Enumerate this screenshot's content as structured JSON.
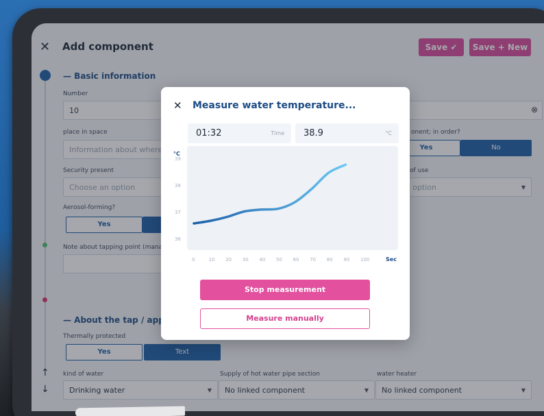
{
  "header": {
    "title": "Add component",
    "save_label": "Save",
    "save_new_label": "Save + New"
  },
  "form": {
    "basic_section": "— Basic information",
    "number_label": "Number",
    "number_value": "10",
    "place_label": "place in space",
    "place_placeholder": "Information about where t",
    "order_label": "onent; in order?",
    "order_yes": "Yes",
    "order_no": "No",
    "security_label": "Security present",
    "security_placeholder": "Choose an option",
    "use_label": "of use",
    "use_placeholder": "an option",
    "aerosol_label": "Aerosol-forming?",
    "aerosol_yes": "Yes",
    "note_label": "Note about tapping point (manag",
    "tap_section": "— About the tap / applia",
    "thermal_label": "Thermally protected",
    "thermal_yes": "Yes",
    "thermal_text": "Text",
    "kind_label": "kind of water",
    "kind_value": "Drinking water",
    "supply_label": "Supply of hot water pipe section",
    "supply_value": "No linked component",
    "heater_label": "water heater",
    "heater_value": "No linked component"
  },
  "modal": {
    "title": "Measure water temperature...",
    "time_value": "01:32",
    "time_unit": "Time",
    "temp_value": "38.9",
    "temp_unit": "°C",
    "stop_label": "Stop measurement",
    "manual_label": "Measure manually"
  },
  "chart_data": {
    "type": "line",
    "title": "",
    "xlabel": "Sec",
    "ylabel": "°C",
    "x_ticks": [
      "0",
      "10",
      "20",
      "30",
      "40",
      "50",
      "60",
      "70",
      "80",
      "90",
      "100"
    ],
    "y_ticks": [
      "39",
      "38",
      "37",
      "36"
    ],
    "xlim": [
      0,
      100
    ],
    "ylim": [
      35.6,
      39.5
    ],
    "grid": false,
    "series": [
      {
        "x": [
          0,
          10,
          20,
          30,
          40,
          50,
          60,
          70,
          80,
          90
        ],
        "y": [
          36.6,
          36.7,
          36.85,
          37.05,
          37.12,
          37.15,
          37.4,
          37.9,
          38.5,
          38.8
        ]
      }
    ],
    "colors": [
      "#1d5fa8",
      "#6cc7f2"
    ]
  }
}
